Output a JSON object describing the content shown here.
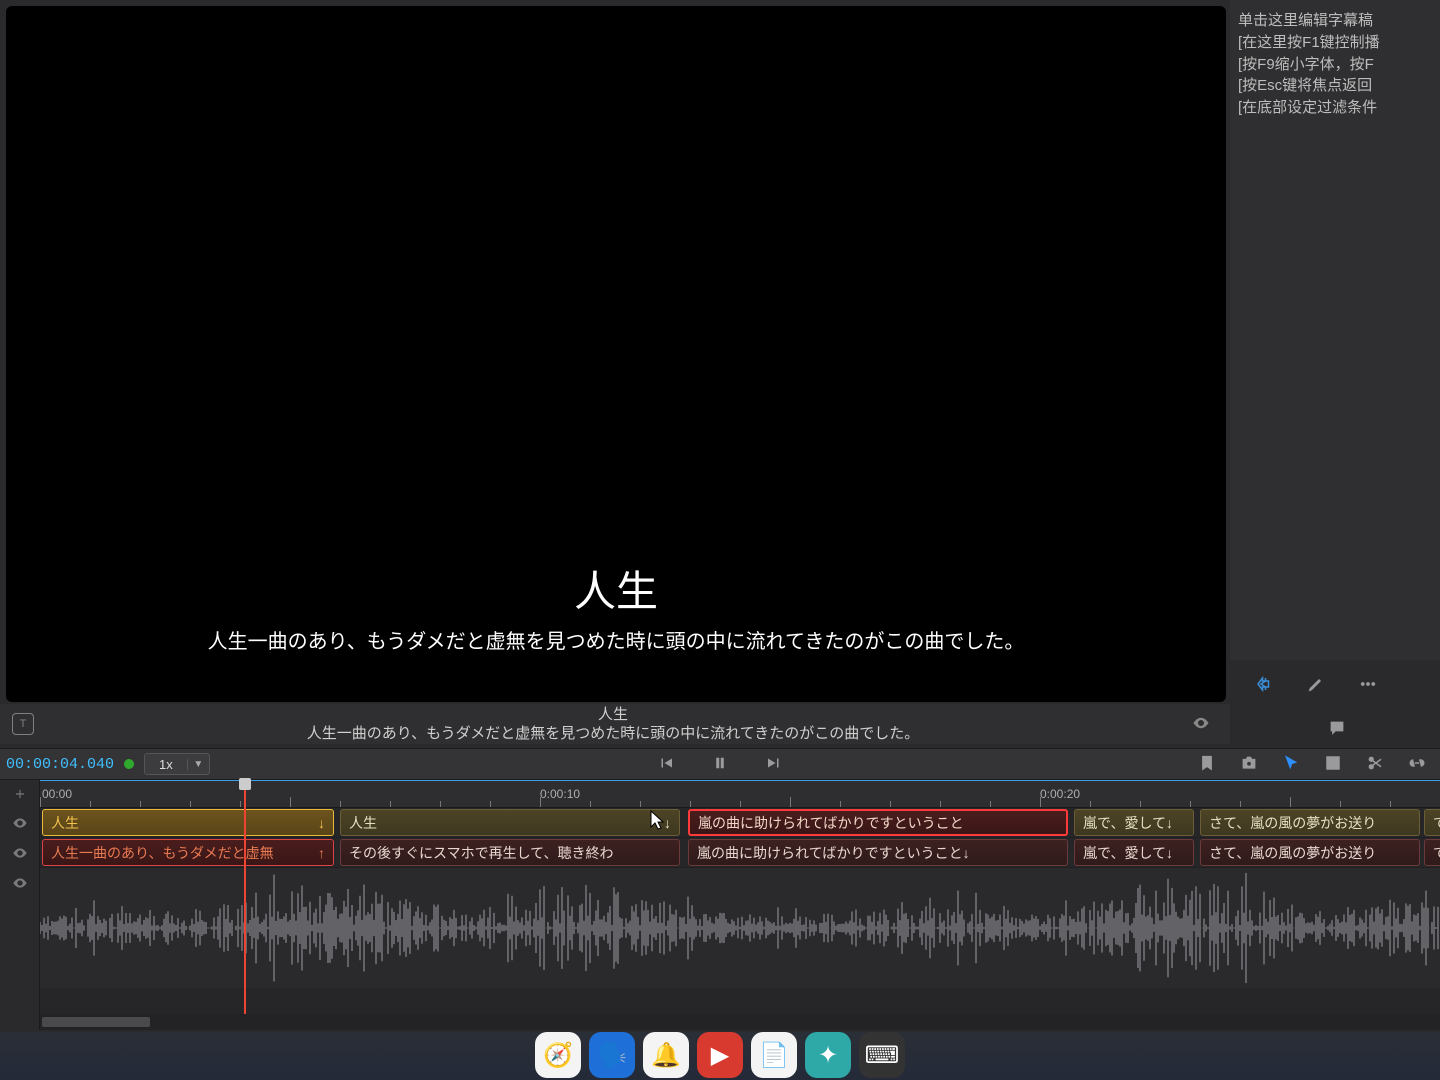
{
  "preview": {
    "subtitle_top": "人生",
    "subtitle_bottom": "人生一曲のあり、もうダメだと虚無を見つめた時に頭の中に流れてきたのがこの曲でした。"
  },
  "side_hints": {
    "line1": "单击这里编辑字幕稿",
    "line2": "[在这里按F1键控制播",
    "line3": "[按F9缩小字体，按F",
    "line4": "[按Esc键将焦点返回",
    "line5": "[在底部设定过滤条件"
  },
  "readout": {
    "line1": "人生",
    "line2": "人生一曲のあり、もうダメだと虚無を見つめた時に頭の中に流れてきたのがこの曲でした。"
  },
  "transport": {
    "timecode": "00:00:04.040",
    "speed": "1x"
  },
  "ruler": {
    "t0": "00:00",
    "t10": "0:00:10",
    "t20": "0:00:20"
  },
  "track1": {
    "c1": "人生",
    "c2": "人生",
    "c3": "嵐の曲に助けられてばかりですということ",
    "c4": "嵐で、愛して↓",
    "c5": "さて、嵐の風の夢がお送り",
    "c6": "て"
  },
  "track2": {
    "c1": "人生一曲のあり、もうダメだと虚無",
    "c2": "その後すぐにスマホで再生して、聴き終わ",
    "c3": "嵐の曲に助けられてばかりですということ↓",
    "c4": "嵐で、愛して↓",
    "c5": "さて、嵐の風の夢がお送り",
    "c6": "て"
  }
}
